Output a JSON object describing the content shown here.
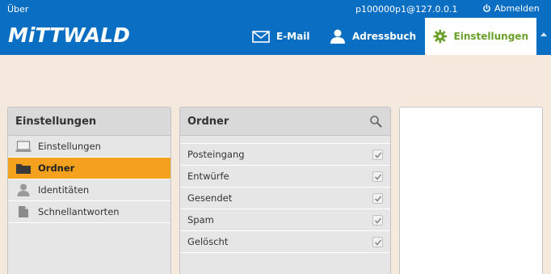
{
  "header": {
    "about": "Über",
    "user": "p100000p1@127.0.0.1",
    "logout": "Abmelden",
    "logo": "MiTTWALD",
    "nav": {
      "mail": "E-Mail",
      "addressbook": "Adressbuch",
      "settings": "Einstellungen"
    }
  },
  "left_panel": {
    "title": "Einstellungen",
    "items": [
      {
        "label": "Einstellungen",
        "icon": "computer-icon"
      },
      {
        "label": "Ordner",
        "icon": "folder-icon",
        "selected": true
      },
      {
        "label": "Identitäten",
        "icon": "person-icon"
      },
      {
        "label": "Schnellantworten",
        "icon": "document-icon"
      }
    ]
  },
  "mid_panel": {
    "title": "Ordner",
    "folders": [
      {
        "label": "Posteingang",
        "subscribed": true
      },
      {
        "label": "Entwürfe",
        "subscribed": true
      },
      {
        "label": "Gesendet",
        "subscribed": true
      },
      {
        "label": "Spam",
        "subscribed": true
      },
      {
        "label": "Gelöscht",
        "subscribed": true
      }
    ]
  },
  "colors": {
    "header_bg": "#0a6fc2",
    "accent_green": "#6aa12a",
    "selected_orange": "#f4a11e",
    "page_bg": "#f5e8dc"
  }
}
